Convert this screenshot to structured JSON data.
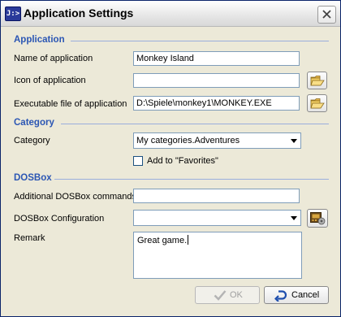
{
  "window": {
    "title": "Application Settings",
    "icon_text": "J:>"
  },
  "application": {
    "heading": "Application",
    "name_label": "Name of application",
    "name_value": "Monkey Island",
    "icon_label": "Icon of application",
    "icon_value": "",
    "exe_label": "Executable file of application",
    "exe_value": "D:\\Spiele\\monkey1\\MONKEY.EXE"
  },
  "category": {
    "heading": "Category",
    "category_label": "Category",
    "category_value": "My categories.Adventures",
    "favorites_label": "Add to \"Favorites\"",
    "favorites_checked": false
  },
  "dosbox": {
    "heading": "DOSBox",
    "commands_label": "Additional DOSBox commands",
    "commands_value": "",
    "config_label": "DOSBox Configuration",
    "config_value": "",
    "remark_label": "Remark",
    "remark_value": "Great game."
  },
  "buttons": {
    "ok_label": "OK",
    "ok_enabled": false,
    "cancel_label": "Cancel"
  },
  "icons": {
    "browse": "folder-open-icon",
    "config": "dosbox-config-icon",
    "close": "close-icon"
  },
  "colors": {
    "section_heading": "#2b56b4",
    "field_border": "#7f9db9",
    "window_bg": "#ece9d8"
  }
}
